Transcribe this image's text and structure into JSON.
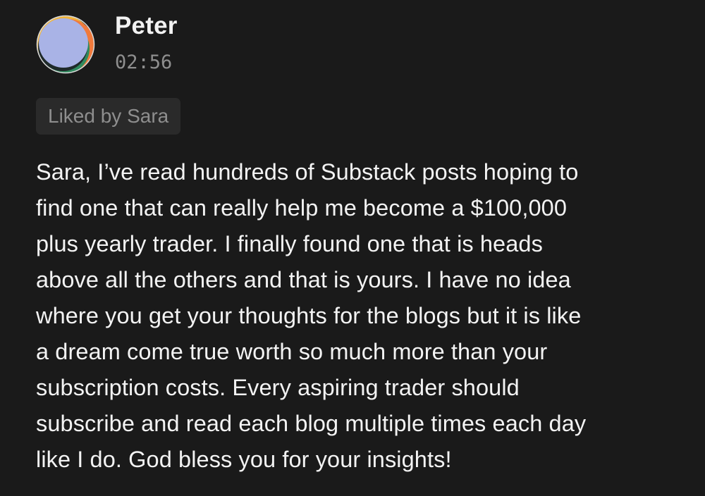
{
  "comment": {
    "author": "Peter",
    "timestamp": "02:56",
    "liked_by": "Liked by Sara",
    "body_lines": [
      "Sara, I’ve read hundreds of Substack posts hoping to",
      "find one that can really help me become a $100,000",
      "plus yearly trader. I finally found one that is heads",
      "above all the others and that is yours. I have no idea",
      "where you get your thoughts for the blogs but it is like",
      "a dream come true worth so much more than your",
      "subscription costs. Every aspiring trader should",
      "subscribe and read each blog multiple times each day",
      "like I do. God bless you for your insights!"
    ]
  },
  "avatar": {
    "icon": "user-avatar-icon",
    "colors": {
      "face": "#a9b3e6",
      "rim_orange": "#f07a3c",
      "rim_green": "#2f8a5e",
      "rim_yellow": "#f0b43c",
      "rim_dark": "#1f2a2a"
    }
  },
  "theme": {
    "background": "#1a1a1a",
    "text": "#f3f3f3",
    "muted": "#8e8e8e",
    "badge_bg": "#2a2a2a"
  }
}
